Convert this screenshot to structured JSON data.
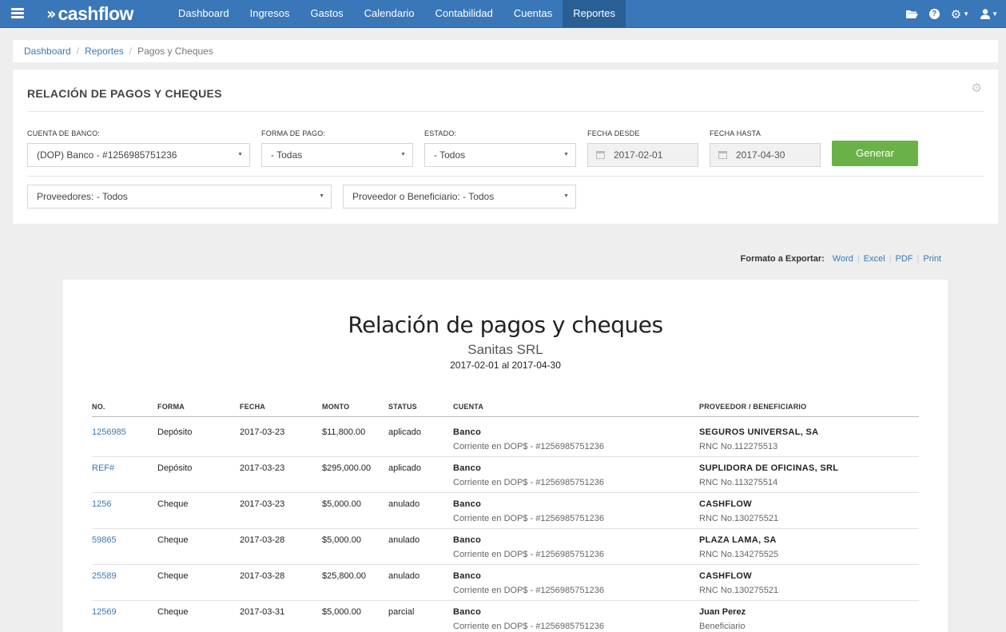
{
  "nav": {
    "brand": "cashflow",
    "links": [
      "Dashboard",
      "Ingresos",
      "Gastos",
      "Calendario",
      "Contabilidad",
      "Cuentas",
      "Reportes"
    ],
    "active": "Reportes"
  },
  "breadcrumb": [
    "Dashboard",
    "Reportes",
    "Pagos y Cheques"
  ],
  "filters": {
    "title": "RELACIÓN DE PAGOS Y CHEQUES",
    "cuenta_label": "CUENTA DE BANCO:",
    "cuenta_value": "(DOP) Banco - #1256985751236",
    "forma_label": "FORMA DE PAGO:",
    "forma_value": "- Todas",
    "estado_label": "ESTADO:",
    "estado_value": "- Todos",
    "desde_label": "FECHA DESDE",
    "desde_value": "2017-02-01",
    "hasta_label": "FECHA HASTA",
    "hasta_value": "2017-04-30",
    "generar": "Generar",
    "proveedores_value": "Proveedores: - Todos",
    "beneficiario_value": "Proveedor o Beneficiario: - Todos"
  },
  "export": {
    "label": "Formato a Exportar:",
    "options": [
      "Word",
      "Excel",
      "PDF",
      "Print"
    ]
  },
  "report": {
    "title": "Relación de pagos y cheques",
    "company": "Sanitas SRL",
    "range": "2017-02-01 al 2017-04-30",
    "headers": [
      "NO.",
      "FORMA",
      "FECHA",
      "MONTO",
      "STATUS",
      "CUENTA",
      "PROVEEDOR / BENEFICIARIO"
    ],
    "rows": [
      {
        "no": "1256985",
        "forma": "Depósito",
        "fecha": "2017-03-23",
        "monto": "$11,800.00",
        "status": "aplicado",
        "cuenta": "Banco",
        "cuenta_det": "Corriente en DOP$ - #1256985751236",
        "prov": "SEGUROS UNIVERSAL, SA",
        "prov_det": "RNC No.112275513"
      },
      {
        "no": "REF#",
        "forma": "Depósito",
        "fecha": "2017-03-23",
        "monto": "$295,000.00",
        "status": "aplicado",
        "cuenta": "Banco",
        "cuenta_det": "Corriente en DOP$ - #1256985751236",
        "prov": "SUPLIDORA DE OFICINAS, SRL",
        "prov_det": "RNC No.113275514"
      },
      {
        "no": "1256",
        "forma": "Cheque",
        "fecha": "2017-03-23",
        "monto": "$5,000.00",
        "status": "anulado",
        "cuenta": "Banco",
        "cuenta_det": "Corriente en DOP$ - #1256985751236",
        "prov": "CASHFLOW",
        "prov_det": "RNC No.130275521"
      },
      {
        "no": "59865",
        "forma": "Cheque",
        "fecha": "2017-03-28",
        "monto": "$5,000.00",
        "status": "anulado",
        "cuenta": "Banco",
        "cuenta_det": "Corriente en DOP$ - #1256985751236",
        "prov": "PLAZA LAMA, SA",
        "prov_det": "RNC No.134275525"
      },
      {
        "no": "25589",
        "forma": "Cheque",
        "fecha": "2017-03-28",
        "monto": "$25,800.00",
        "status": "anulado",
        "cuenta": "Banco",
        "cuenta_det": "Corriente en DOP$ - #1256985751236",
        "prov": "CASHFLOW",
        "prov_det": "RNC No.130275521"
      },
      {
        "no": "12569",
        "forma": "Cheque",
        "fecha": "2017-03-31",
        "monto": "$5,000.00",
        "status": "parcial",
        "cuenta": "Banco",
        "cuenta_det": "Corriente en DOP$ - #1256985751236",
        "prov": "Juan Perez",
        "prov_det": "Beneficiario"
      }
    ]
  }
}
